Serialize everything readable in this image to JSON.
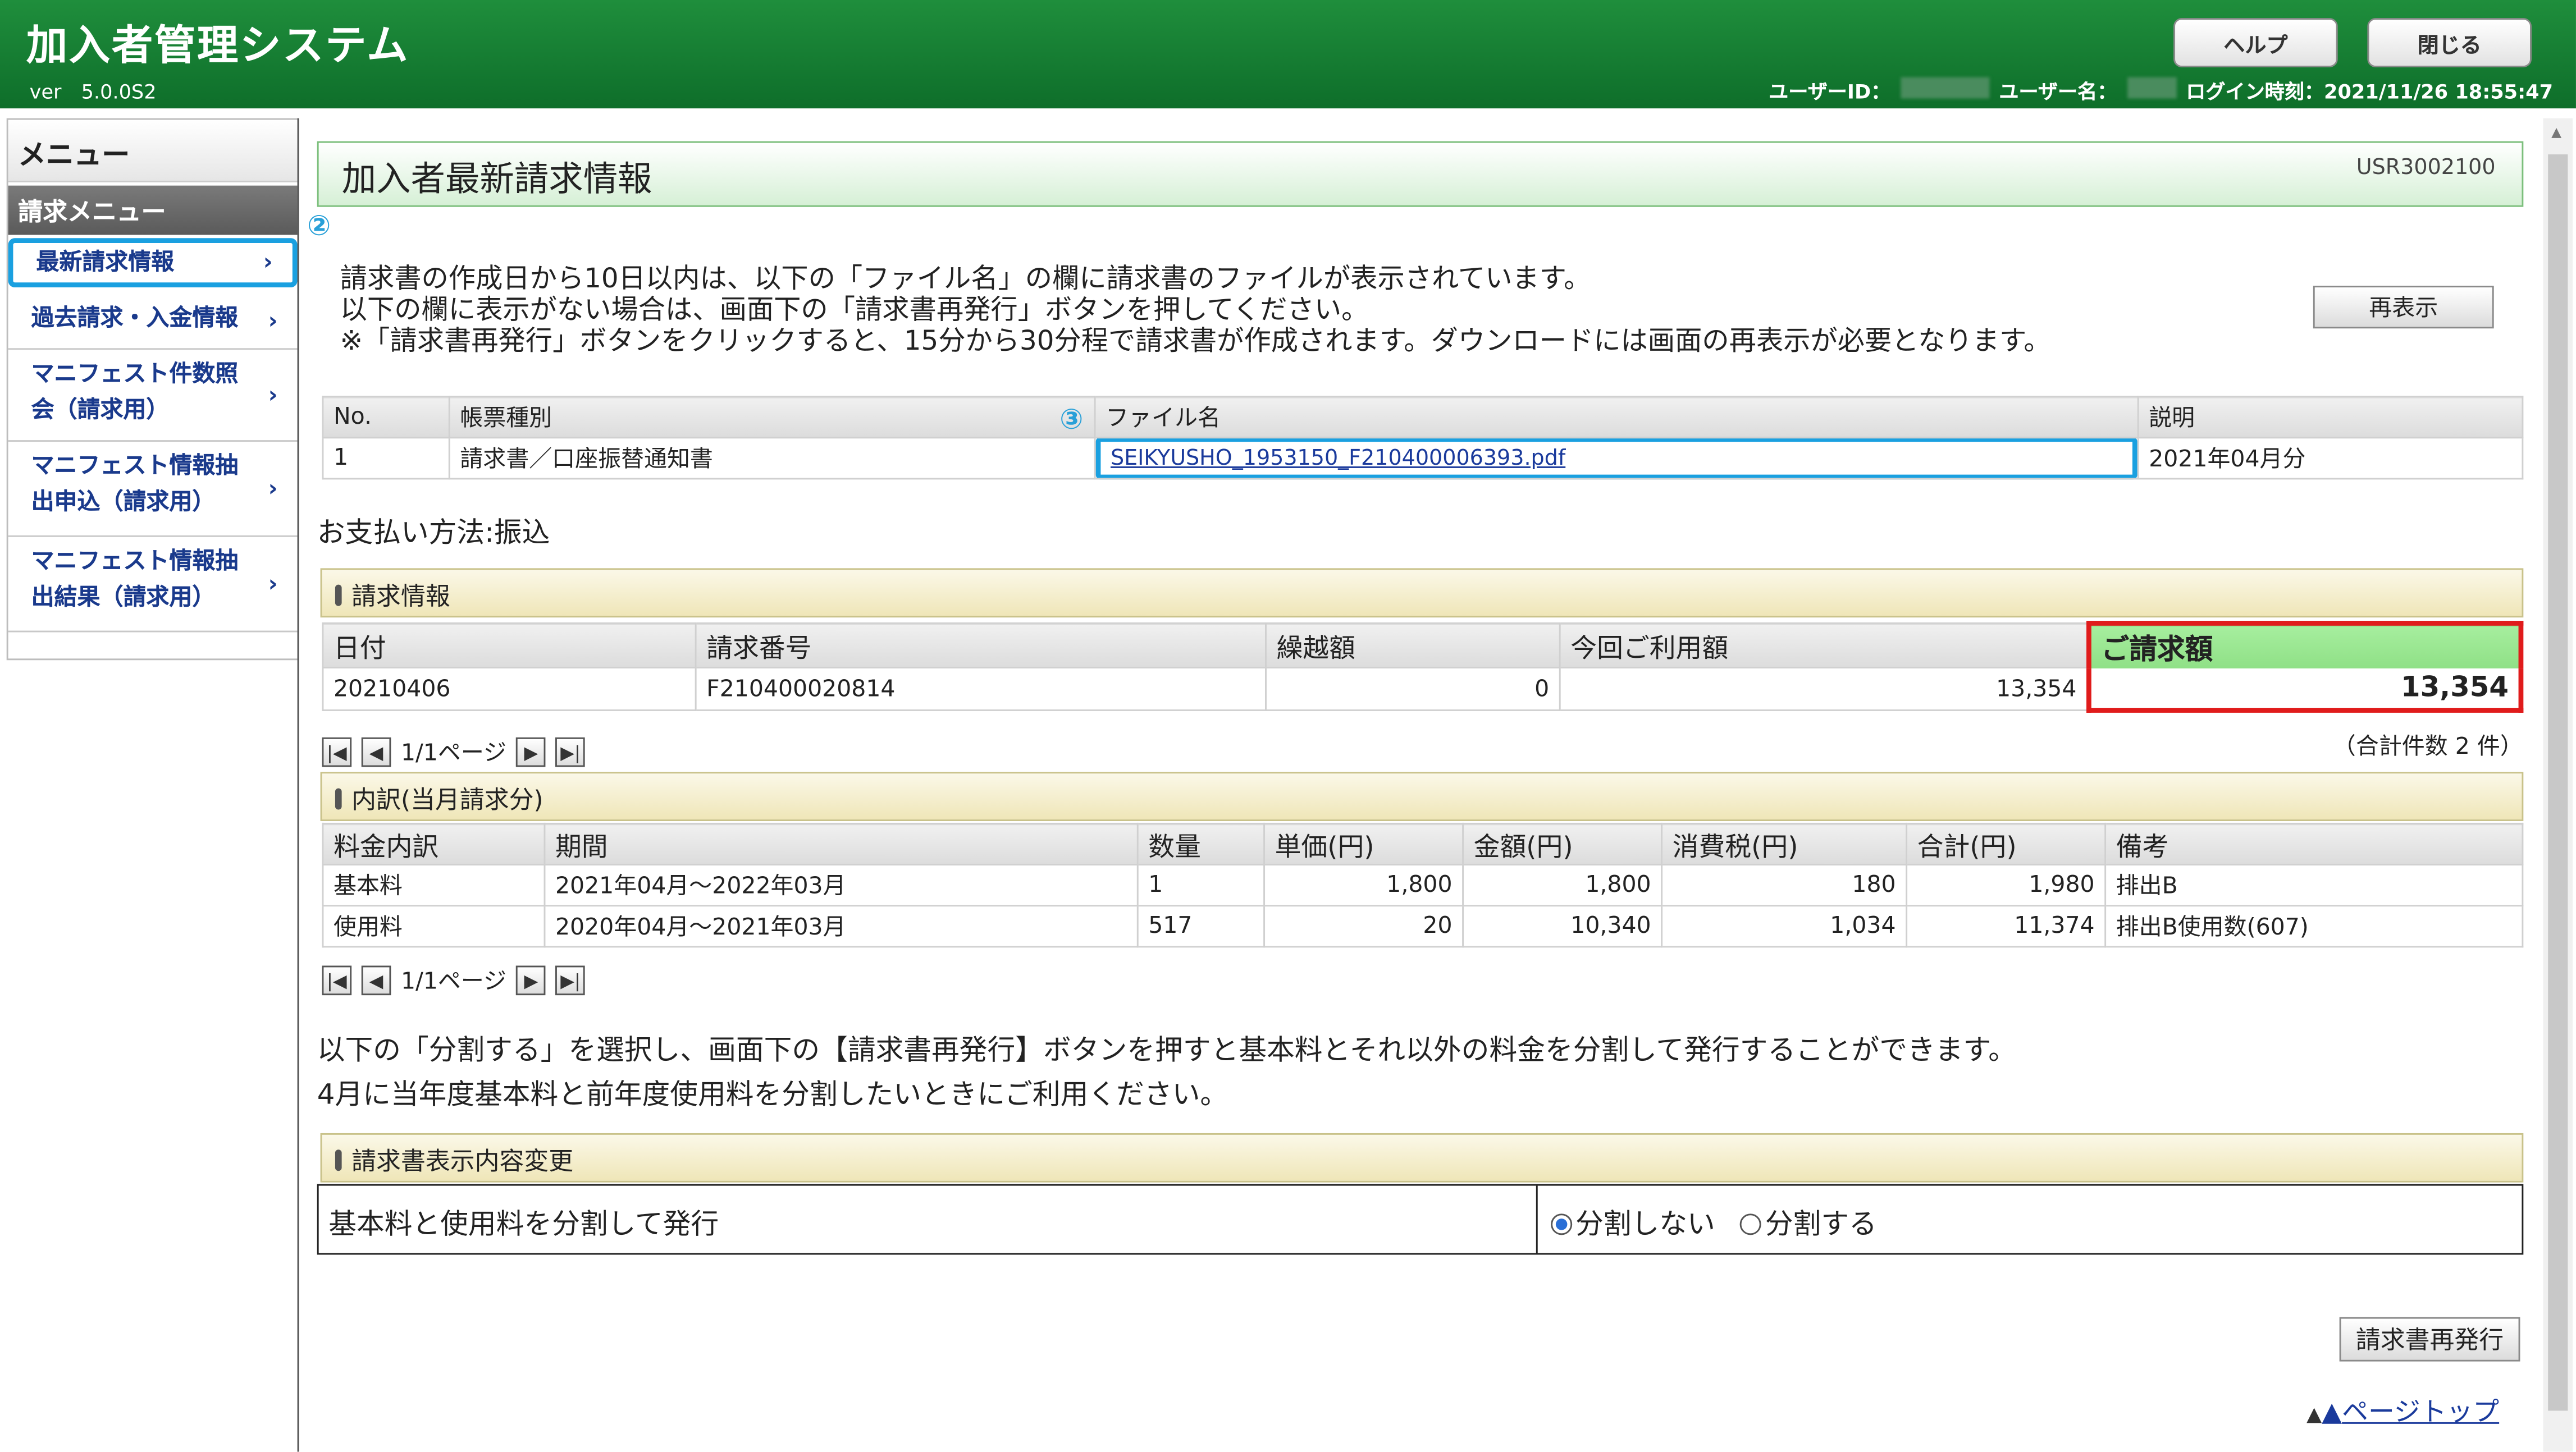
{
  "header": {
    "app_title": "加入者管理システム",
    "version": "ver　5.0.0S2",
    "help_label": "ヘルプ",
    "close_label": "閉じる",
    "user_id_label": "ユーザーID：",
    "user_name_label": "ユーザー名：",
    "login_time_label": "ログイン時刻：2021/11/26 18:55:47",
    "bg_color": "#1a843a"
  },
  "sidebar": {
    "title": "メニュー",
    "section": "請求メニュー",
    "items": [
      {
        "label": "最新請求情報"
      },
      {
        "label": "過去請求・入金情報"
      },
      {
        "label": "マニフェスト件数照会（請求用）"
      },
      {
        "label": "マニフェスト情報抽出申込（請求用）"
      },
      {
        "label": "マニフェスト情報抽出結果（請求用）"
      }
    ]
  },
  "page": {
    "title": "加入者最新請求情報",
    "screen_id": "USR3002100",
    "messages": [
      "請求書の作成日から10日以内は、以下の「ファイル名」の欄に請求書のファイルが表示されています。",
      "以下の欄に表示がない場合は、画面下の「請求書再発行」ボタンを押してください。",
      "※「請求書再発行」ボタンをクリックすると、15分から30分程で請求書が作成されます。ダウンロードには画面の再表示が必要となります。"
    ],
    "refresh_label": "再表示",
    "annotation_2": "②",
    "annotation_3": "③"
  },
  "files_table": {
    "headers": [
      "No.",
      "帳票種別",
      "ファイル名",
      "説明"
    ],
    "rows": [
      [
        "1",
        "請求書／口座振替通知書",
        "SEIKYUSHO_1953150_F210400006393.pdf",
        "2021年04月分"
      ]
    ]
  },
  "payment_method": "お支払い方法:振込",
  "billing_info": {
    "section_title": "請求情報",
    "headers": [
      "日付",
      "請求番号",
      "繰越額",
      "今回ご利用額",
      "ご請求額"
    ],
    "rows": [
      [
        "20210406",
        "F210400020814",
        "0",
        "13,354",
        "13,354"
      ]
    ],
    "highlight_color": "#e01b1b"
  },
  "pager1": {
    "page_text": "1/1ページ",
    "total_text": "（合計件数 2 件）"
  },
  "breakdown": {
    "section_title": "内訳(当月請求分)",
    "headers": [
      "料金内訳",
      "期間",
      "数量",
      "単価(円)",
      "金額(円)",
      "消費税(円)",
      "合計(円)",
      "備考"
    ],
    "rows": [
      [
        "基本料",
        "2021年04月～2022年03月",
        "1",
        "1,800",
        "1,800",
        "180",
        "1,980",
        "排出B"
      ],
      [
        "使用料",
        "2020年04月～2021年03月",
        "517",
        "20",
        "10,340",
        "1,034",
        "11,374",
        "排出B使用数(607)"
      ]
    ]
  },
  "pager2": {
    "page_text": "1/1ページ"
  },
  "split_notes": [
    "以下の「分割する」を選択し、画面下の【請求書再発行】ボタンを押すと基本料とそれ以外の料金を分割して発行することができます。",
    "4月に当年度基本料と前年度使用料を分割したいときにご利用ください。"
  ],
  "display_change": {
    "section_title": "請求書表示内容変更",
    "row_label": "基本料と使用料を分割して発行",
    "option_no": "分割しない",
    "option_yes": "分割する",
    "selected": "分割しない"
  },
  "reissue_label": "請求書再発行",
  "page_top_label": "ページトップ"
}
